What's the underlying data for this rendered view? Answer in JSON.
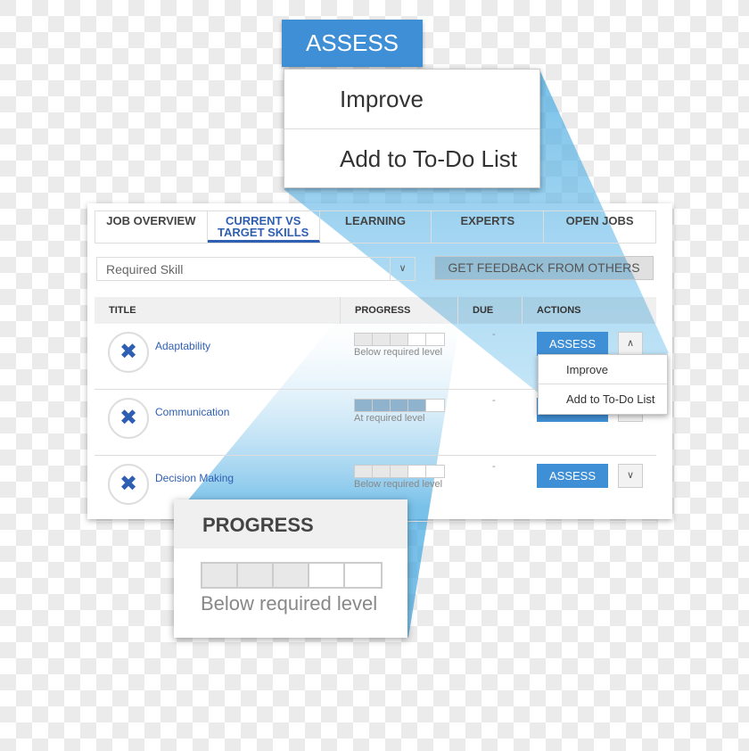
{
  "callout_menu": {
    "button_label": "ASSESS",
    "items": [
      "Improve",
      "Add to To-Do List"
    ]
  },
  "tabs": [
    {
      "label": "JOB OVERVIEW",
      "active": false
    },
    {
      "label": "CURRENT VS TARGET SKILLS",
      "active": true
    },
    {
      "label": "LEARNING",
      "active": false
    },
    {
      "label": "EXPERTS",
      "active": false
    },
    {
      "label": "OPEN JOBS",
      "active": false
    }
  ],
  "filter": {
    "value": "Required Skill"
  },
  "feedback_button": "GET FEEDBACK FROM OTHERS",
  "columns": [
    "TITLE",
    "PROGRESS",
    "DUE",
    "ACTIONS"
  ],
  "rows": [
    {
      "title": "Adaptability",
      "progress_filled": 3,
      "progress_total": 5,
      "level": "Below required level",
      "due": "-",
      "action": "ASSESS",
      "menu_open": true
    },
    {
      "title": "Communication",
      "progress_filled": 4,
      "progress_total": 5,
      "level": "At required level",
      "due": "-",
      "action": "ASSESS",
      "menu_open": false
    },
    {
      "title": "Decision Making",
      "progress_filled": 3,
      "progress_total": 5,
      "level": "Below required level",
      "due": "-",
      "action": "ASSESS",
      "menu_open": false
    }
  ],
  "row_menu": [
    "Improve",
    "Add to To-Do List"
  ],
  "progress_callout": {
    "heading": "PROGRESS",
    "progress_filled": 3,
    "progress_total": 5,
    "level": "Below required level"
  },
  "colors": {
    "accent": "#3f8fd6",
    "link": "#2f5fb3",
    "filled": "#e8e8e8",
    "filled_at": "#8fb3cc"
  }
}
